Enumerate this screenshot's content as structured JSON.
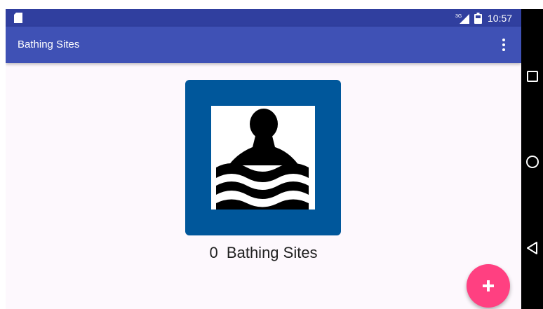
{
  "status_bar": {
    "network_type": "3G",
    "time": "10:57",
    "icons": [
      "sd-card-icon",
      "signal-icon",
      "battery-icon"
    ]
  },
  "app_bar": {
    "title": "Bathing Sites",
    "menu_icon": "overflow-menu-icon"
  },
  "main": {
    "logo_icon": "swimmer-icon",
    "site_count": "0",
    "count_label": "Bathing Sites"
  },
  "fab": {
    "icon": "plus-icon"
  },
  "nav_bar": {
    "icons": [
      "recents-icon",
      "home-icon",
      "back-icon"
    ]
  },
  "colors": {
    "status_bar": "#303f9f",
    "app_bar": "#3f51b5",
    "sign_blue": "#00579b",
    "fab": "#ff4081",
    "background": "#fdf8fd"
  }
}
